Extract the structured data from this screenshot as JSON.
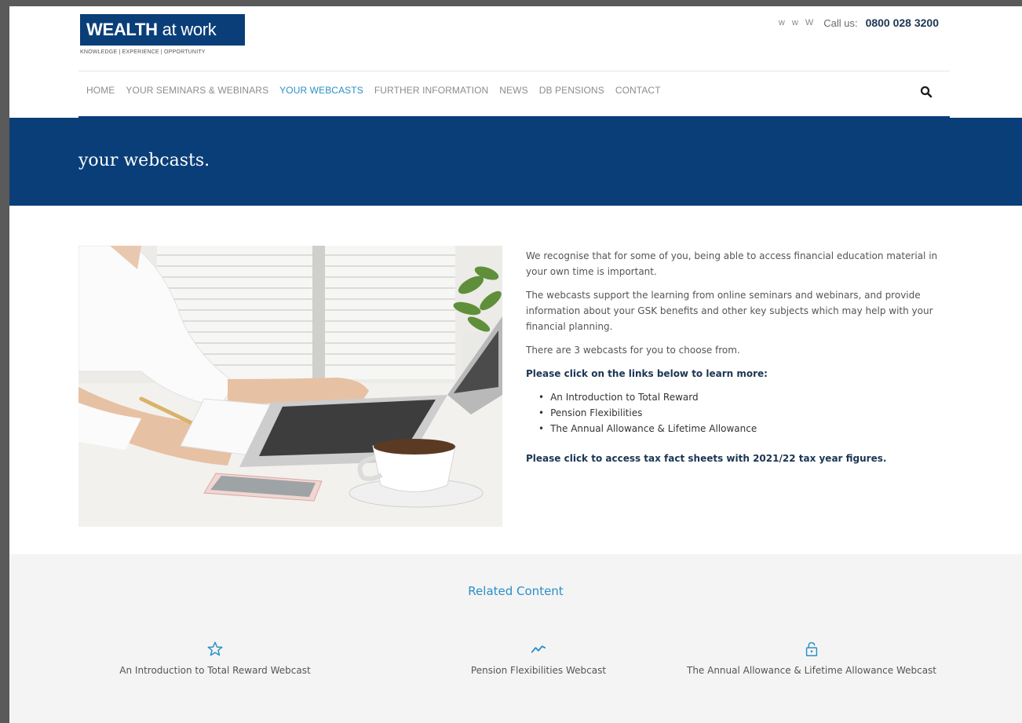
{
  "header": {
    "logo_main": "WEALTH",
    "logo_sub": "at work",
    "logo_tagline": "KNOWLEDGE | EXPERIENCE | OPPORTUNITY",
    "social": "w w W",
    "call_label": "Call us:",
    "call_number": "0800 028 3200"
  },
  "nav": {
    "items": [
      {
        "label": "HOME"
      },
      {
        "label": "YOUR SEMINARS & WEBINARS"
      },
      {
        "label": "YOUR WEBCASTS"
      },
      {
        "label": "FURTHER INFORMATION"
      },
      {
        "label": "NEWS"
      },
      {
        "label": "DB PENSIONS"
      },
      {
        "label": "CONTACT"
      }
    ],
    "active": "YOUR WEBCASTS",
    "search_icon": "search-icon"
  },
  "banner": {
    "title": "your webcasts."
  },
  "content": {
    "p1": "We recognise that for some of you, being able to access financial education material in your own time is important.",
    "p2": "The webcasts support the learning from online seminars and webinars, and provide information about your GSK benefits and other key subjects which may help with your financial planning.",
    "p3": "There are 3 webcasts for you to choose from.",
    "p4": "Please click on the links below to learn more:",
    "links": [
      "An Introduction to Total Reward",
      "Pension Flexibilities",
      "The Annual Allowance & Lifetime Allowance"
    ],
    "tax_link": "Please click to access tax fact sheets with 2021/22 tax year figures."
  },
  "related": {
    "title": "Related Content",
    "items": [
      {
        "icon": "star-icon",
        "label": "An Introduction to Total Reward Webcast"
      },
      {
        "icon": "trend-line-icon",
        "label": "Pension Flexibilities Webcast"
      },
      {
        "icon": "unlock-icon",
        "label": "The Annual Allowance & Lifetime Allowance Webcast"
      }
    ]
  },
  "colors": {
    "brand_navy": "#0a3e78",
    "accent_blue": "#2a8fc6"
  }
}
